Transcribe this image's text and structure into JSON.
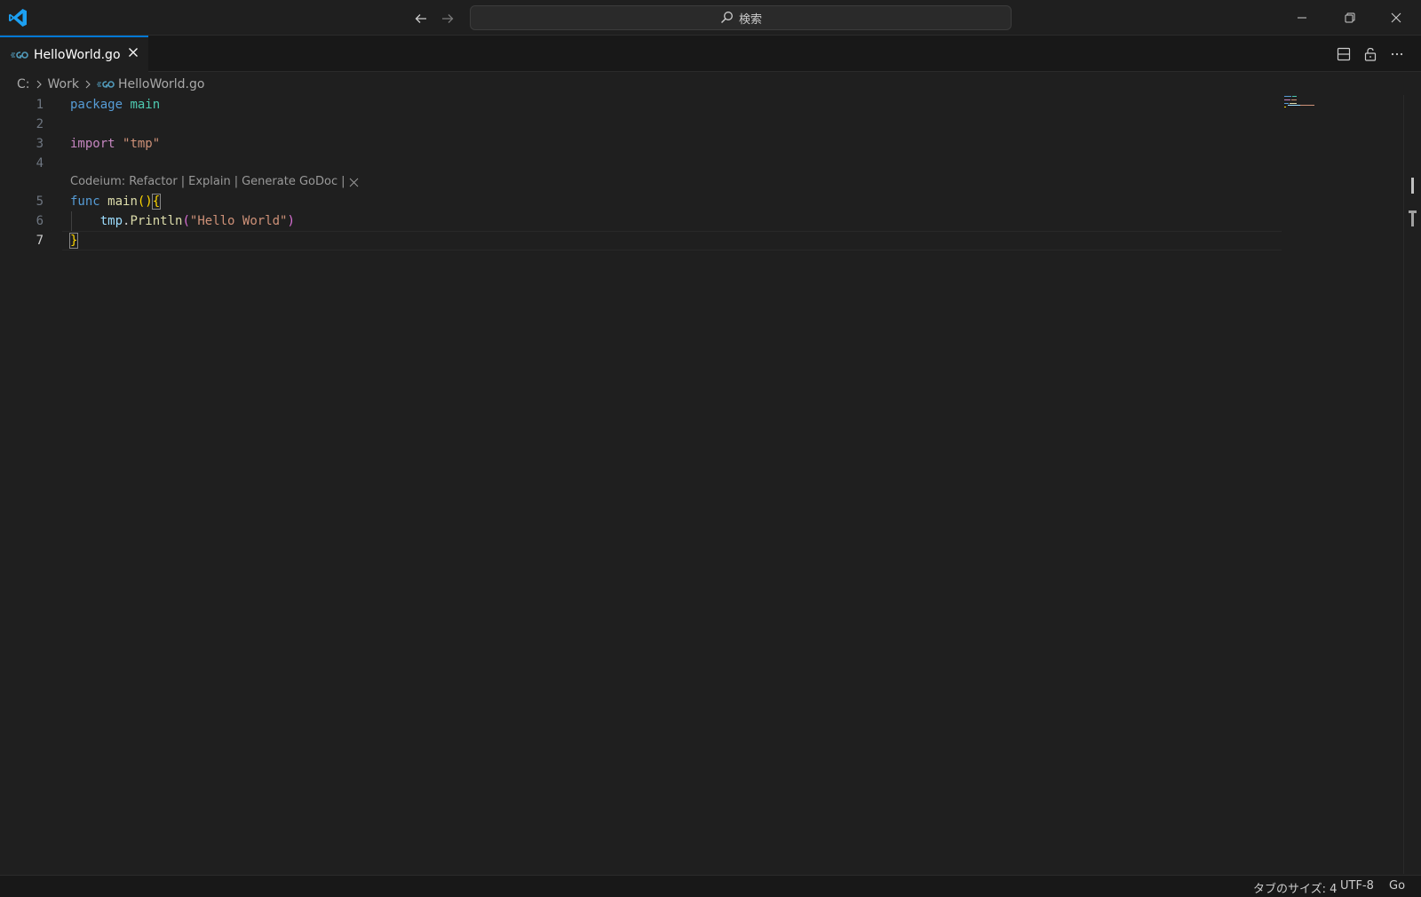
{
  "titlebar": {
    "search_placeholder": "検索"
  },
  "tab": {
    "label": "HelloWorld.go"
  },
  "breadcrumb": {
    "drive": "C:",
    "folder": "Work",
    "file": "HelloWorld.go"
  },
  "editor": {
    "line_numbers": [
      "1",
      "2",
      "3",
      "4",
      "5",
      "6",
      "7"
    ],
    "active_line": 7,
    "lines": {
      "l1_kw": "package",
      "l1_name": "main",
      "l3_kw": "import",
      "l3_str": "\"tmp\"",
      "l5_kw": "func",
      "l5_fn": "main",
      "l5_parens": "()",
      "l5_brace": "{",
      "l6_pkg": "tmp",
      "l6_dot": ".",
      "l6_fn": "Println",
      "l6_open": "(",
      "l6_str": "\"Hello World\"",
      "l6_close": ")",
      "l7_brace": "}"
    },
    "codelens": {
      "prefix": "Codeium:",
      "refactor": "Refactor",
      "explain": "Explain",
      "generate": "Generate GoDoc",
      "sep": "|"
    }
  },
  "statusbar": {
    "tab_size": "タブのサイズ: 4",
    "encoding": "UTF-8",
    "language": "Go"
  },
  "colors": {
    "accent": "#0078d4",
    "background": "#1f1f1f",
    "go_icon": "#519aba"
  }
}
